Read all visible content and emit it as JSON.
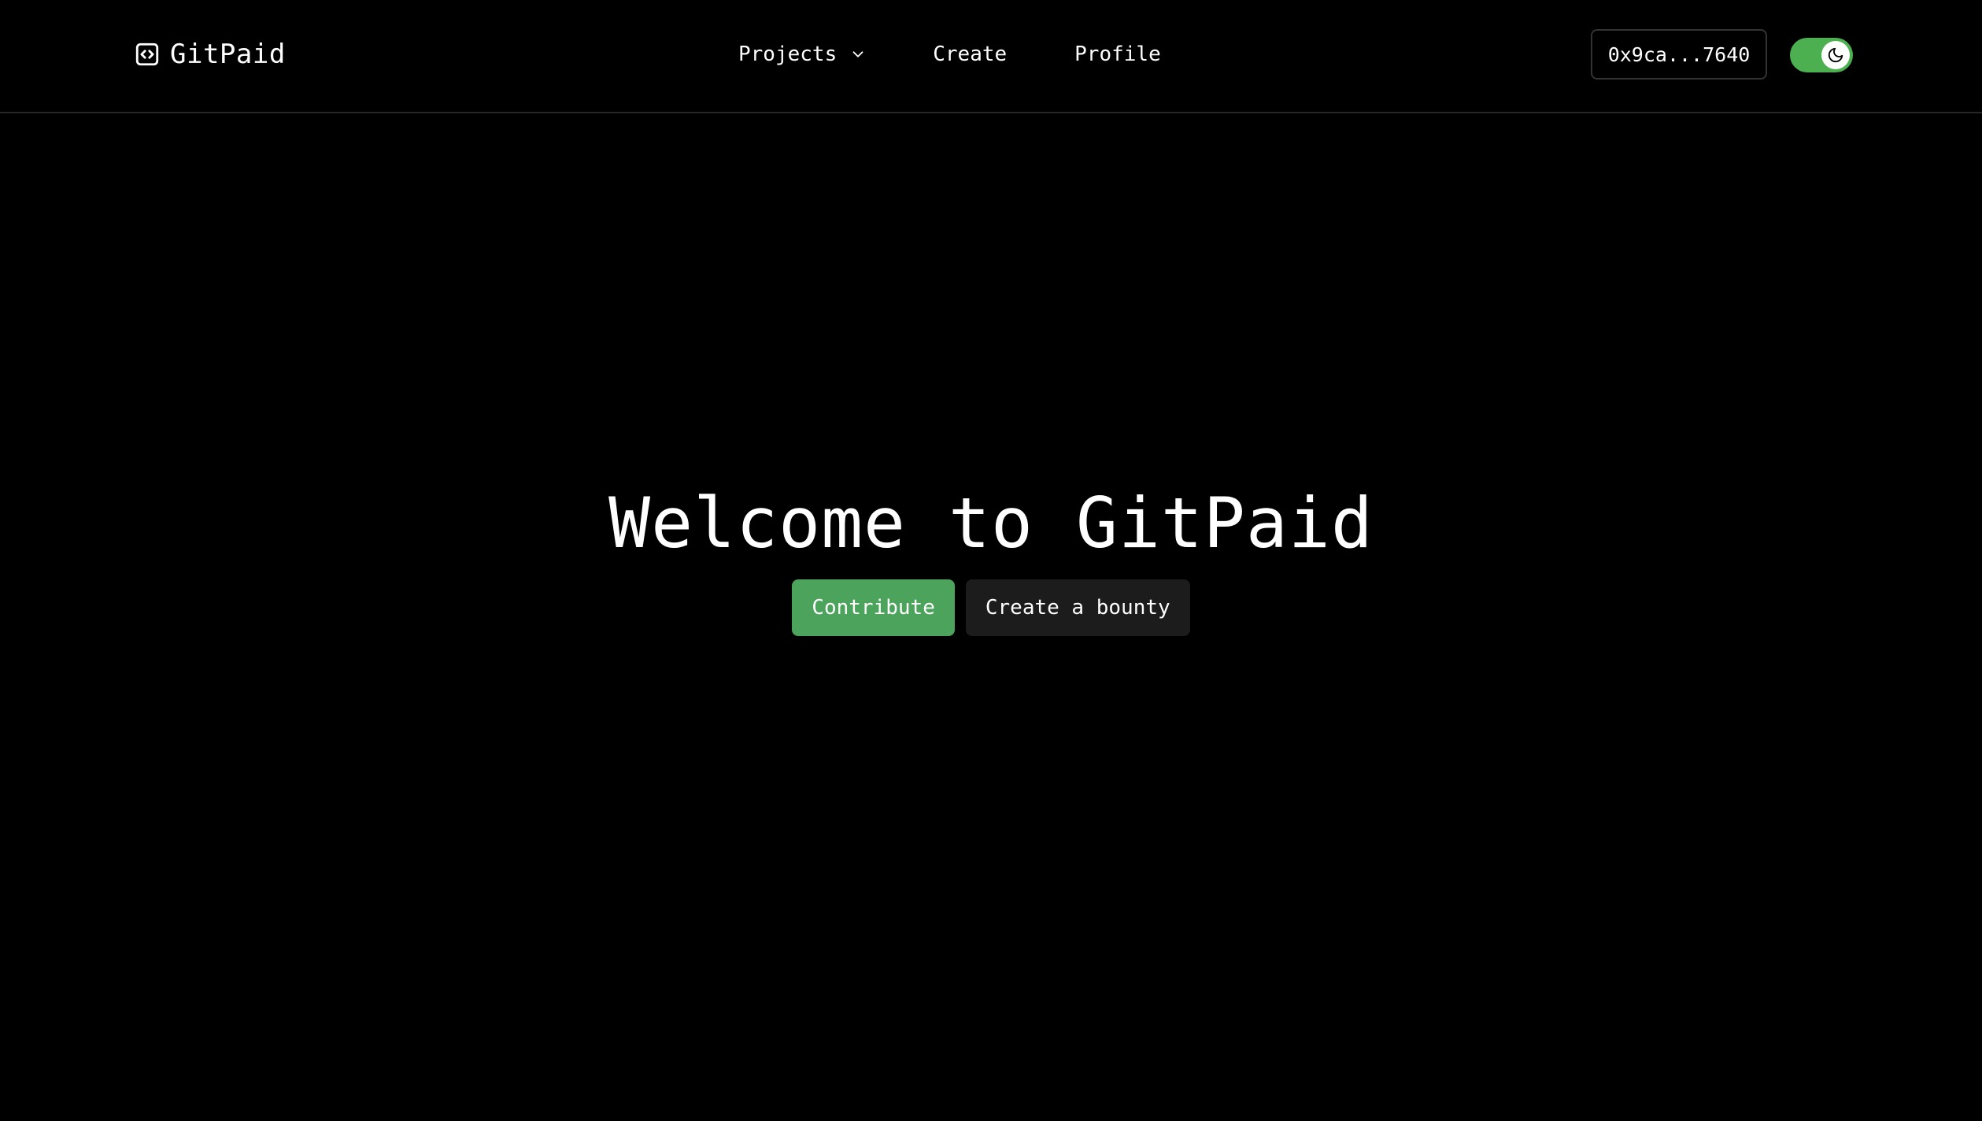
{
  "header": {
    "brand": {
      "name": "GitPaid",
      "icon": "code-square-icon"
    },
    "nav": {
      "projects_label": "Projects",
      "projects_icon": "chevron-down-icon",
      "create_label": "Create",
      "profile_label": "Profile"
    },
    "wallet_address": "0x9ca...7640",
    "theme_toggle": {
      "state": "on",
      "icon": "moon-icon",
      "color": "#4caf50"
    }
  },
  "hero": {
    "title": "Welcome to GitPaid",
    "primary_button": "Contribute",
    "secondary_button": "Create a bounty"
  },
  "colors": {
    "background": "#000000",
    "accent": "#4ca35b",
    "secondary_button": "#1c1c1c",
    "text": "#ffffff"
  }
}
